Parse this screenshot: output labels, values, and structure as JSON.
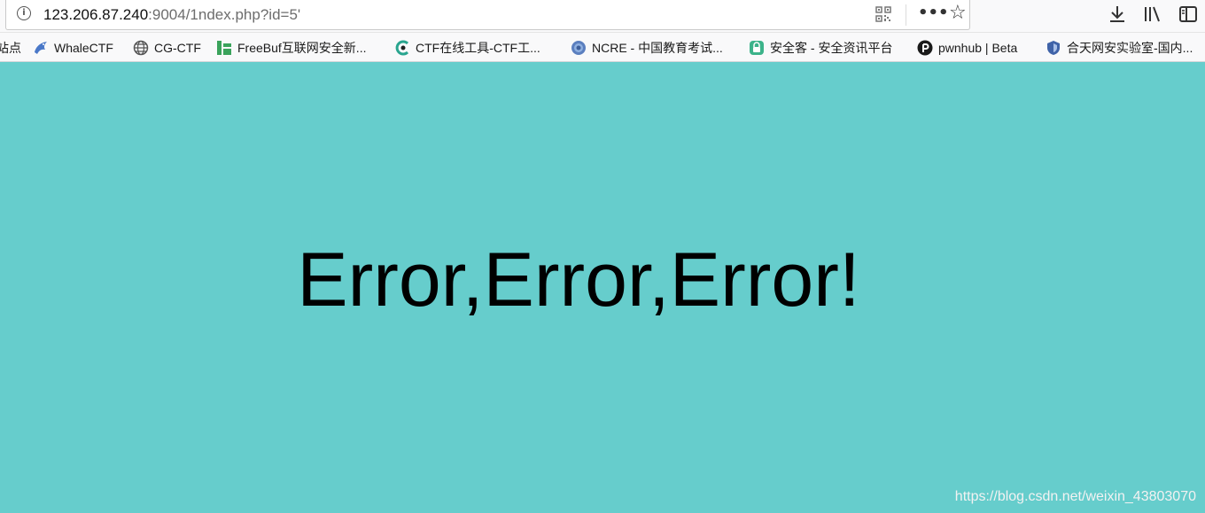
{
  "browser": {
    "url_host": "123.206.87.240",
    "url_rest": ":9004/1ndex.php?id=5'",
    "more_glyph": "•••",
    "star_glyph": "☆",
    "info_glyph": "i"
  },
  "bookmarks": [
    {
      "label": "站点",
      "icon": "none"
    },
    {
      "label": "WhaleCTF",
      "icon": "whale-icon"
    },
    {
      "label": "CG-CTF",
      "icon": "globe-icon"
    },
    {
      "label": "FreeBuf互联网安全新...",
      "icon": "freebuf-icon"
    },
    {
      "label": "CTF在线工具-CTF工...",
      "icon": "ctf-tool-icon"
    },
    {
      "label": "NCRE - 中国教育考试...",
      "icon": "ncre-icon"
    },
    {
      "label": "安全客 - 安全资讯平台",
      "icon": "anquanke-icon"
    },
    {
      "label": "pwnhub | Beta",
      "icon": "pwnhub-icon"
    },
    {
      "label": "合天网安实验室-国内...",
      "icon": "shield-icon"
    }
  ],
  "page": {
    "message": "Error,Error,Error!",
    "background": "#66cdcc",
    "watermark": "https://blog.csdn.net/weixin_43803070"
  }
}
